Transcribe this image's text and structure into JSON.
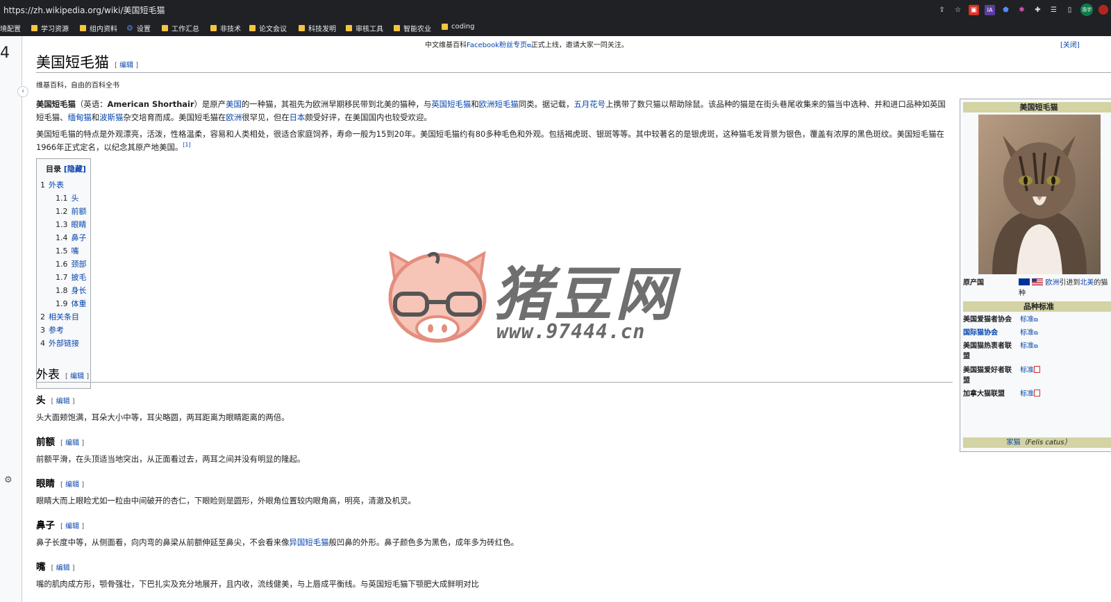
{
  "browser": {
    "url": "https://zh.wikipedia.org/wiki/美国短毛猫",
    "toolbar_icons": [
      "share-icon",
      "star-icon",
      "extension-red-icon",
      "ia-icon",
      "shield-icon",
      "colorful-icon",
      "puzzle-icon",
      "reading-list-icon",
      "sidebar-icon"
    ],
    "profile_label": "浩宇",
    "bookmarks": [
      {
        "label": "境配置",
        "icon": "none"
      },
      {
        "label": "学习资源",
        "icon": "folder-icon"
      },
      {
        "label": "组内资料",
        "icon": "folder-icon"
      },
      {
        "label": "设置",
        "icon": "gear-icon"
      },
      {
        "label": "工作汇总",
        "icon": "folder-icon"
      },
      {
        "label": "非技术",
        "icon": "folder-icon"
      },
      {
        "label": "论文会议",
        "icon": "folder-icon"
      },
      {
        "label": "科技发明",
        "icon": "folder-icon"
      },
      {
        "label": "审核工具",
        "icon": "folder-icon"
      },
      {
        "label": "智能农业",
        "icon": "folder-icon"
      },
      {
        "label": "coding",
        "icon": "folder-icon"
      }
    ]
  },
  "rail": {
    "glyph": "4"
  },
  "notice": {
    "before": "中文维基百科",
    "link": "Facebook粉丝专页",
    "after": "正式上线，邀请大家一同关注。",
    "close": "[关闭]"
  },
  "article": {
    "title": "美国短毛猫",
    "edit": "编辑",
    "tagline": "维基百科，自由的百科全书",
    "p1": [
      {
        "t": "美国短毛猫",
        "b": true
      },
      {
        "t": "（英语："
      },
      {
        "t": "American Shorthair",
        "b": true
      },
      {
        "t": "）是原产"
      },
      {
        "t": "美国",
        "link": true
      },
      {
        "t": "的一种猫，其祖先为欧洲早期移民带到北美的猫种，与"
      },
      {
        "t": "英国短毛猫",
        "link": true
      },
      {
        "t": "和"
      },
      {
        "t": "欧洲短毛猫",
        "link": true
      },
      {
        "t": "同类。据记载，"
      },
      {
        "t": "五月花号",
        "link": true
      },
      {
        "t": "上携带了数只猫以帮助除鼠。该品种的猫是在街头巷尾收集来的猫当中选种、并和进口品种如英国短毛猫、"
      },
      {
        "t": "缅甸猫",
        "link": true
      },
      {
        "t": "和"
      },
      {
        "t": "波斯猫",
        "link": true
      },
      {
        "t": "杂交培育而成。美国短毛猫在"
      },
      {
        "t": "欧洲",
        "link": true
      },
      {
        "t": "很罕见，但在"
      },
      {
        "t": "日本",
        "link": true
      },
      {
        "t": "颇受好评，在美国国内也较受欢迎。"
      }
    ],
    "p2": "美国短毛猫的特点是外观漂亮，活泼，性格温柔，容易和人类相处，很适合家庭饲养，寿命一般为15到20年。美国短毛猫约有80多种毛色和外观。包括褐虎斑、银斑等等。其中较著名的是银虎斑，这种猫毛发背景为银色，覆盖有浓厚的黑色斑纹。美国短毛猫在1966年正式定名，以纪念其原产地美国。",
    "p2_ref": "[1]"
  },
  "toc": {
    "title": "目录",
    "hide": "[隐藏]",
    "items": [
      {
        "num": "1",
        "label": "外表",
        "level": 1
      },
      {
        "num": "1.1",
        "label": "头",
        "level": 2
      },
      {
        "num": "1.2",
        "label": "前额",
        "level": 2
      },
      {
        "num": "1.3",
        "label": "眼睛",
        "level": 2
      },
      {
        "num": "1.4",
        "label": "鼻子",
        "level": 2
      },
      {
        "num": "1.5",
        "label": "嘴",
        "level": 2
      },
      {
        "num": "1.6",
        "label": "颈部",
        "level": 2
      },
      {
        "num": "1.7",
        "label": "披毛",
        "level": 2
      },
      {
        "num": "1.8",
        "label": "身长",
        "level": 2
      },
      {
        "num": "1.9",
        "label": "体重",
        "level": 2
      },
      {
        "num": "2",
        "label": "相关条目",
        "level": 1
      },
      {
        "num": "3",
        "label": "参考",
        "level": 1
      },
      {
        "num": "4",
        "label": "外部链接",
        "level": 1
      }
    ]
  },
  "sections": {
    "appearance": "外表",
    "head": {
      "title": "头",
      "text": "头大面颊饱满，耳朵大小中等，耳尖略圆，两耳距离为眼睛距离的两倍。"
    },
    "forehead": {
      "title": "前额",
      "text": "前额平滑，在头顶适当地突出，从正面看过去，两耳之间并没有明显的隆起。"
    },
    "eyes": {
      "title": "眼睛",
      "text": "眼睛大而上眼睑尤如一粒由中间破开的杏仁，下眼睑则是圆形，外眼角位置较内眼角高，明亮，清澈及机灵。"
    },
    "nose": {
      "title": "鼻子",
      "before": "鼻子长度中等，从侧面看，向内弯的鼻梁从前额伸延至鼻尖，不会看来像",
      "link": "异国短毛猫",
      "after": "般凹鼻的外形。鼻子颜色多为黑色，成年多为砖红色。"
    },
    "mouth": {
      "title": "嘴",
      "text": "嘴的肌肉成方形，颚骨强壮，下巴扎实及充分地展开，且内收，流线健美，与上唇成平衡线。与英国短毛猫下颚肥大成鲜明对比"
    }
  },
  "infobox": {
    "title": "美国短毛猫",
    "origin_label": "原产国",
    "origin_link1": "欧洲",
    "origin_mid": "引进到",
    "origin_link2": "北美",
    "origin_after": "的猫",
    "origin_line2": "种",
    "standards_header": "品种标准",
    "standards": [
      {
        "org": "美国爱猫者协会",
        "org2": "",
        "link": false,
        "value": "标准",
        "kind": "ext"
      },
      {
        "org": "国际猫协会",
        "org2": "",
        "link": true,
        "value": "标准",
        "kind": "ext"
      },
      {
        "org": "美国猫热衷者联",
        "org2": "盟",
        "link": false,
        "value": "标准",
        "kind": "ext"
      },
      {
        "org": "美国猫爱好者联",
        "org2": "盟",
        "link": false,
        "value": "标准",
        "kind": "pdf"
      },
      {
        "org": "加拿大猫联盟",
        "org2": "",
        "link": false,
        "value": "标准",
        "kind": "pdf"
      }
    ],
    "footer_link": "家猫",
    "footer_latin": "（Felis catus）"
  },
  "watermark": {
    "text": "猪豆网",
    "url": "www.97444.cn"
  },
  "colors": {
    "link": "#0645ad",
    "infobox_header": "#d3d3a4",
    "chrome": "#202124"
  }
}
